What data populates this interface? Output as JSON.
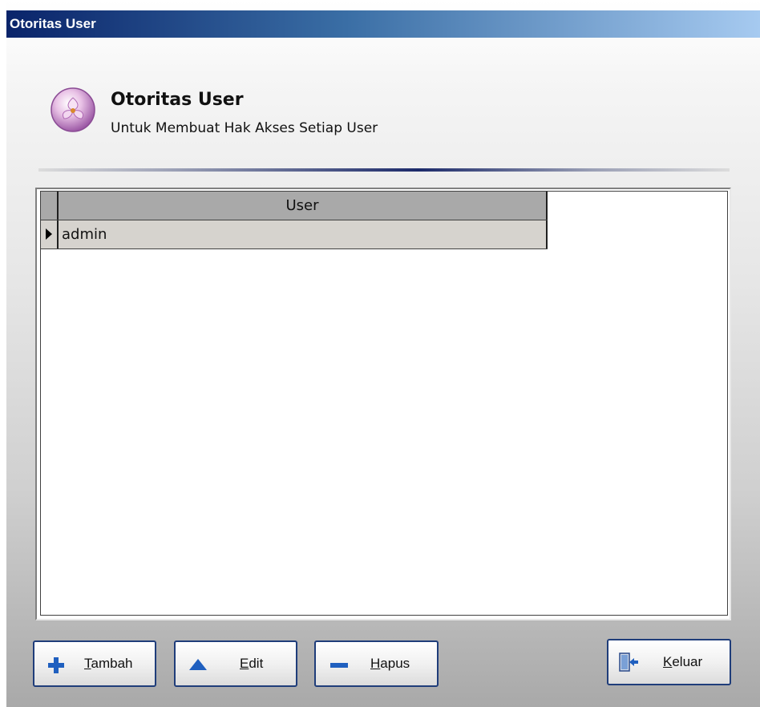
{
  "window": {
    "title": "Otoritas User"
  },
  "header": {
    "title": "Otoritas User",
    "subtitle": "Untuk Membuat Hak Akses Setiap User",
    "icon": "orchid-emblem-icon"
  },
  "grid": {
    "columns": [
      "User"
    ],
    "rows": [
      {
        "user": "admin",
        "current": true
      }
    ]
  },
  "buttons": {
    "tambah": {
      "label_first": "T",
      "label_rest": "ambah",
      "icon": "plus-icon",
      "icon_color": "#1f5fbf"
    },
    "edit": {
      "label_first": "E",
      "label_rest": "dit",
      "icon": "triangle-up-icon",
      "icon_color": "#1f5fbf"
    },
    "hapus": {
      "label_first": "H",
      "label_rest": "apus",
      "icon": "minus-icon",
      "icon_color": "#1f5fbf"
    },
    "keluar": {
      "label_first": "K",
      "label_rest": "eluar",
      "icon": "exit-door-icon",
      "icon_color": "#1f5fbf"
    }
  },
  "colors": {
    "title_bar_start": "#0a246a",
    "title_bar_end": "#a6caf0",
    "grid_header": "#a9a9a9",
    "selected_row": "#d6d3ce",
    "button_border": "#1f3d7a"
  }
}
